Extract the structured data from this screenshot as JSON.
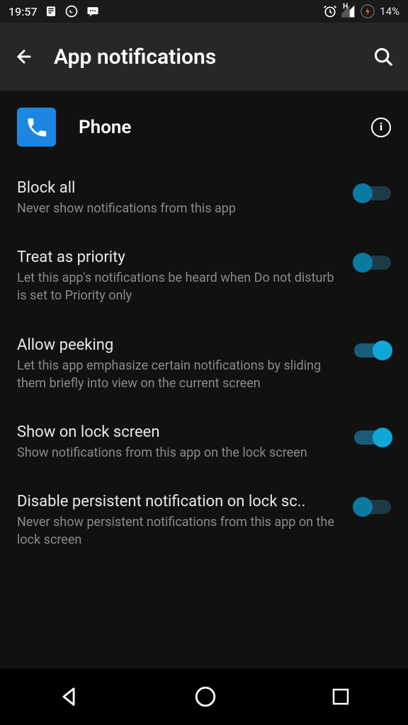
{
  "status": {
    "time": "19:57",
    "battery_pct": "14%"
  },
  "header": {
    "title": "App notifications"
  },
  "app": {
    "name": "Phone"
  },
  "settings": [
    {
      "title": "Block all",
      "desc": "Never show notifications from this app",
      "state": "on-dim"
    },
    {
      "title": "Treat as priority",
      "desc": "Let this app's notifications be heard when Do not disturb is set to Priority only",
      "state": "on-dim"
    },
    {
      "title": "Allow peeking",
      "desc": "Let this app emphasize certain notifications by sliding them briefly into view on the current screen",
      "state": "on-bright"
    },
    {
      "title": "Show on lock screen",
      "desc": "Show notifications from this app on the lock screen",
      "state": "on-bright"
    },
    {
      "title": "Disable persistent notification on lock sc..",
      "desc": "Never show persistent notifications from this app on the lock screen",
      "state": "on-dim"
    }
  ]
}
